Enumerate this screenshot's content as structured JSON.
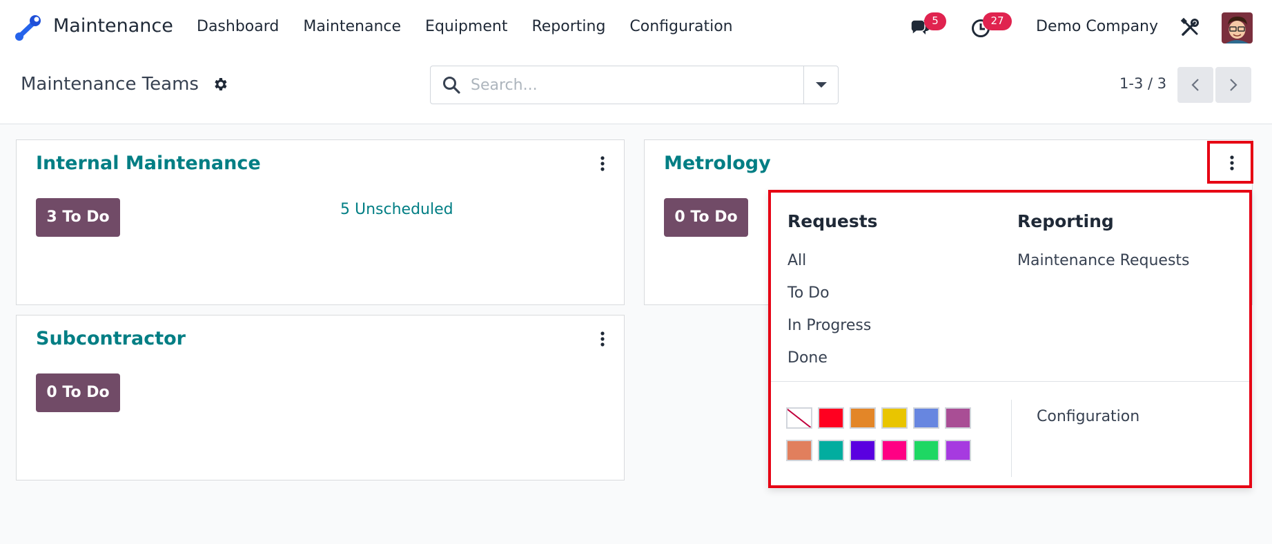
{
  "navbar": {
    "app_name": "Maintenance",
    "menu": [
      "Dashboard",
      "Maintenance",
      "Equipment",
      "Reporting",
      "Configuration"
    ],
    "chat_count": "5",
    "activity_count": "27",
    "company": "Demo Company"
  },
  "control": {
    "title": "Maintenance Teams",
    "search_placeholder": "Search...",
    "pager": "1-3 / 3"
  },
  "cards": [
    {
      "name": "Internal Maintenance",
      "todo": "3 To Do",
      "unscheduled": "5 Unscheduled"
    },
    {
      "name": "Metrology",
      "todo": "0 To Do"
    },
    {
      "name": "Subcontractor",
      "todo": "0 To Do"
    }
  ],
  "dropdown": {
    "requests_heading": "Requests",
    "requests_items": [
      "All",
      "To Do",
      "In Progress",
      "Done"
    ],
    "reporting_heading": "Reporting",
    "reporting_items": [
      "Maintenance Requests"
    ],
    "configuration": "Configuration",
    "colors": [
      "none",
      "#ff0020",
      "#e38628",
      "#e9c500",
      "#6786e0",
      "#a94e95",
      "#e17f5d",
      "#02ad9f",
      "#5a00e0",
      "#ff0084",
      "#1ed763",
      "#a63ae0"
    ]
  }
}
